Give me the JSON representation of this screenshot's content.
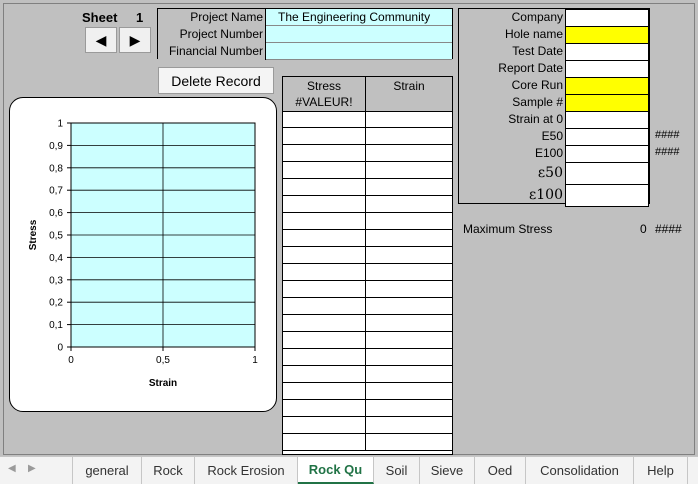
{
  "sheet": {
    "label": "Sheet",
    "number": "1"
  },
  "buttons": {
    "delete": "Delete Record"
  },
  "project": {
    "rows": [
      {
        "label": "Project Name",
        "value": "The Engineering Community"
      },
      {
        "label": "Project Number",
        "value": ""
      },
      {
        "label": "Financial Number",
        "value": ""
      }
    ]
  },
  "info": {
    "rows": [
      {
        "label": "Company",
        "highlight": false,
        "hash": ""
      },
      {
        "label": "Hole name",
        "highlight": true,
        "hash": ""
      },
      {
        "label": "Test Date",
        "highlight": false,
        "hash": ""
      },
      {
        "label": "Report Date",
        "highlight": false,
        "hash": ""
      },
      {
        "label": "Core Run",
        "highlight": true,
        "hash": ""
      },
      {
        "label": "Sample #",
        "highlight": true,
        "hash": ""
      },
      {
        "label": "Strain at 0",
        "highlight": false,
        "hash": ""
      },
      {
        "label": "E50",
        "highlight": false,
        "hash": "####"
      },
      {
        "label": "E100",
        "highlight": false,
        "hash": "####"
      },
      {
        "label": "ε50",
        "highlight": false,
        "hash": ""
      },
      {
        "label": "ε100",
        "highlight": false,
        "hash": ""
      }
    ]
  },
  "max_stress": {
    "label": "Maximum Stress",
    "value": "0",
    "hash": "####"
  },
  "table": {
    "headers": [
      "Stress",
      "Strain"
    ],
    "subheader": "#VALEUR!"
  },
  "chart_data": {
    "type": "scatter",
    "title": "",
    "xlabel": "Strain",
    "ylabel": "Stress",
    "xlim": [
      0,
      1
    ],
    "ylim": [
      0,
      1
    ],
    "xticks": [
      "0",
      "0,5",
      "1"
    ],
    "yticks": [
      "0",
      "0,1",
      "0,2",
      "0,3",
      "0,4",
      "0,5",
      "0,6",
      "0,7",
      "0,8",
      "0,9",
      "1"
    ],
    "series": [],
    "grid": true
  },
  "tabs": [
    "general",
    "Rock",
    "Rock Erosion",
    "Rock Qu",
    "Soil",
    "Sieve",
    "Oed",
    "Consolidation",
    "Help"
  ],
  "active_tab": "Rock Qu",
  "colors": {
    "cyan": "#ccffff",
    "yellow": "#ffff00",
    "tab_active": "#217346"
  }
}
